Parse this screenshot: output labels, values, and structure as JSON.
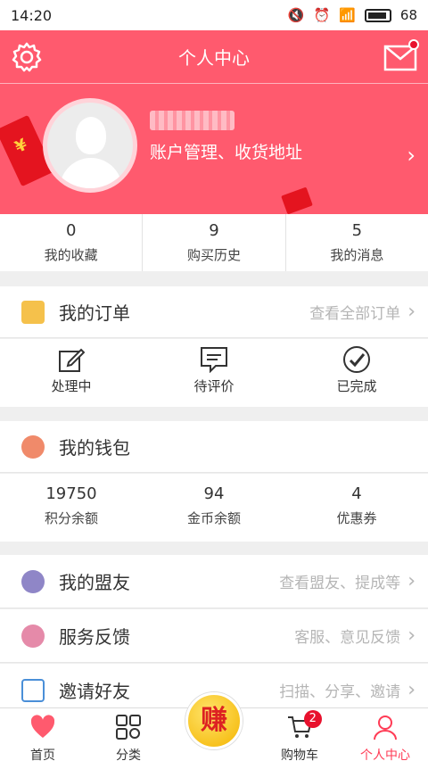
{
  "status": {
    "time": "14:20",
    "battery": "68"
  },
  "header": {
    "title": "个人中心"
  },
  "profile": {
    "account_link": "账户管理、收货地址"
  },
  "stats": [
    {
      "value": "0",
      "label": "我的收藏"
    },
    {
      "value": "9",
      "label": "购买历史"
    },
    {
      "value": "5",
      "label": "我的消息"
    }
  ],
  "orders": {
    "title": "我的订单",
    "more": "查看全部订单",
    "items": [
      {
        "label": "处理中",
        "icon": "edit-icon"
      },
      {
        "label": "待评价",
        "icon": "comment-icon"
      },
      {
        "label": "已完成",
        "icon": "check-circle-icon"
      }
    ]
  },
  "wallet": {
    "title": "我的钱包",
    "items": [
      {
        "value": "19750",
        "label": "积分余额"
      },
      {
        "value": "94",
        "label": "金币余额"
      },
      {
        "value": "4",
        "label": "优惠券"
      }
    ]
  },
  "allies": {
    "title": "我的盟友",
    "more": "查看盟友、提成等"
  },
  "feedback": {
    "title": "服务反馈",
    "more": "客服、意见反馈"
  },
  "invite": {
    "title": "邀请好友",
    "more": "扫描、分享、邀请"
  },
  "nav": {
    "home": "首页",
    "category": "分类",
    "earn": "赚",
    "cart": "购物车",
    "cart_badge": "2",
    "me": "个人中心"
  },
  "colors": {
    "brand": "#ff5a6e",
    "accent": "#e8112d",
    "order_icon": "#f5c14b",
    "wallet_icon": "#f08a6a",
    "allies_icon": "#8f86c7",
    "feedback_icon": "#e58aa9",
    "invite_icon": "#4a8fd8"
  }
}
